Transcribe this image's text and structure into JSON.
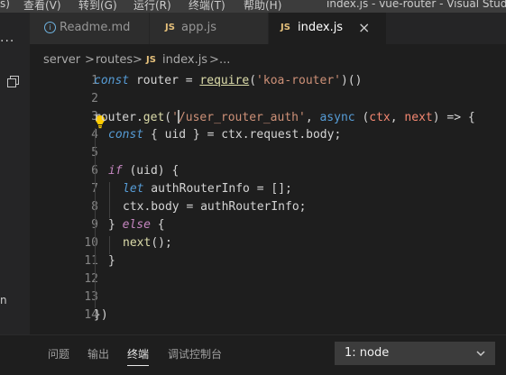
{
  "menu": {
    "items": [
      "s)",
      "查看(V)",
      "转到(G)",
      "运行(R)",
      "终端(T)",
      "帮助(H)"
    ],
    "window_title": "index.js - vue-router - Visual Studio"
  },
  "activity": {
    "overflow": "...",
    "side_fragment": "n"
  },
  "tabs": [
    {
      "icon_text": "i",
      "label": "Readme.md",
      "active": false
    },
    {
      "icon_text": "JS",
      "label": "app.js",
      "active": false
    },
    {
      "icon_text": "JS",
      "label": "index.js",
      "active": true,
      "close": "×"
    }
  ],
  "breadcrumb": {
    "parts": [
      "server",
      "routes",
      "index.js",
      "..."
    ],
    "separator": ">",
    "js_badge": "JS"
  },
  "editor": {
    "line_numbers": [
      "1",
      "2",
      "3",
      "4",
      "5",
      "6",
      "7",
      "8",
      "9",
      "10",
      "11",
      "12",
      "13",
      "14"
    ],
    "lines": {
      "l1": {
        "a": "const",
        "b": " router = ",
        "c": "require",
        "d": "(",
        "e": "'koa-router'",
        "f": ")()"
      },
      "l3": {
        "a": "router.",
        "b": "get",
        "c": "(",
        "d": "'",
        "e": "/user_router_auth'",
        "f": ", ",
        "g": "async",
        "h": " (",
        "i": "ctx",
        "j": ", ",
        "k": "next",
        "l": ") => {"
      },
      "l4": {
        "a": "const",
        "b": " { uid } = ctx.request.body;"
      },
      "l6": {
        "a": "if",
        "b": " (uid) {"
      },
      "l7": {
        "a": "let",
        "b": " authRouterInfo = [];"
      },
      "l8": {
        "a": "ctx.body = authRouterInfo;"
      },
      "l9": {
        "a": "} ",
        "b": "else",
        "c": " {"
      },
      "l10": {
        "a": "next",
        "b": "();"
      },
      "l11": {
        "a": "}"
      },
      "l14": {
        "a": "})"
      }
    }
  },
  "panel": {
    "tabs": [
      "问题",
      "输出",
      "终端",
      "调试控制台"
    ],
    "active_tab": "终端",
    "terminal_select": "1: node"
  },
  "colors": {
    "editor_bg": "#1e1e1e",
    "keyword": "#569cd6",
    "control": "#c586c0",
    "function": "#dcdcaa",
    "string": "#ce9178",
    "parameter": "#f48771",
    "js_icon": "#e5c07b"
  }
}
